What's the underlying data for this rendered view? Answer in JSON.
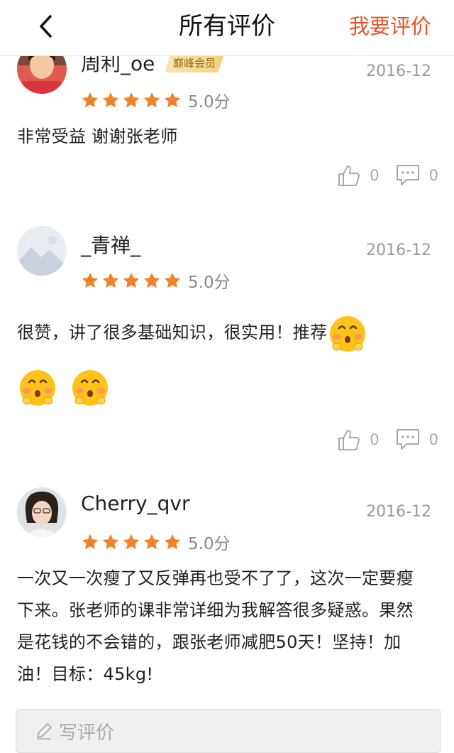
{
  "header": {
    "title": "所有评价",
    "action": "我要评价"
  },
  "reviews": [
    {
      "user": "周利_oe",
      "badge": "巅峰会员",
      "date": "2016-12",
      "score": "5.0分",
      "stars": 5,
      "text": "非常受益 谢谢张老师",
      "likes": "0",
      "comments": "0"
    },
    {
      "user": "_青禅_",
      "date": "2016-12",
      "score": "5.0分",
      "stars": 5,
      "text": "很赞，讲了很多基础知识，很实用！推荐",
      "likes": "0",
      "comments": "0"
    },
    {
      "user": "Cherry_qvr",
      "date": "2016-12",
      "score": "5.0分",
      "stars": 5,
      "text": "一次又一次瘦了又反弹再也受不了了，这次一定要瘦下来。张老师的课非常详细为我解答很多疑惑。果然是花钱的不会错的，跟张老师减肥50天！坚持！加油！目标：45kg!"
    }
  ],
  "write_bar": {
    "placeholder": "写评价"
  },
  "colors": {
    "accent": "#e8542a",
    "star": "#f0822a",
    "muted": "#9a9a9a"
  }
}
